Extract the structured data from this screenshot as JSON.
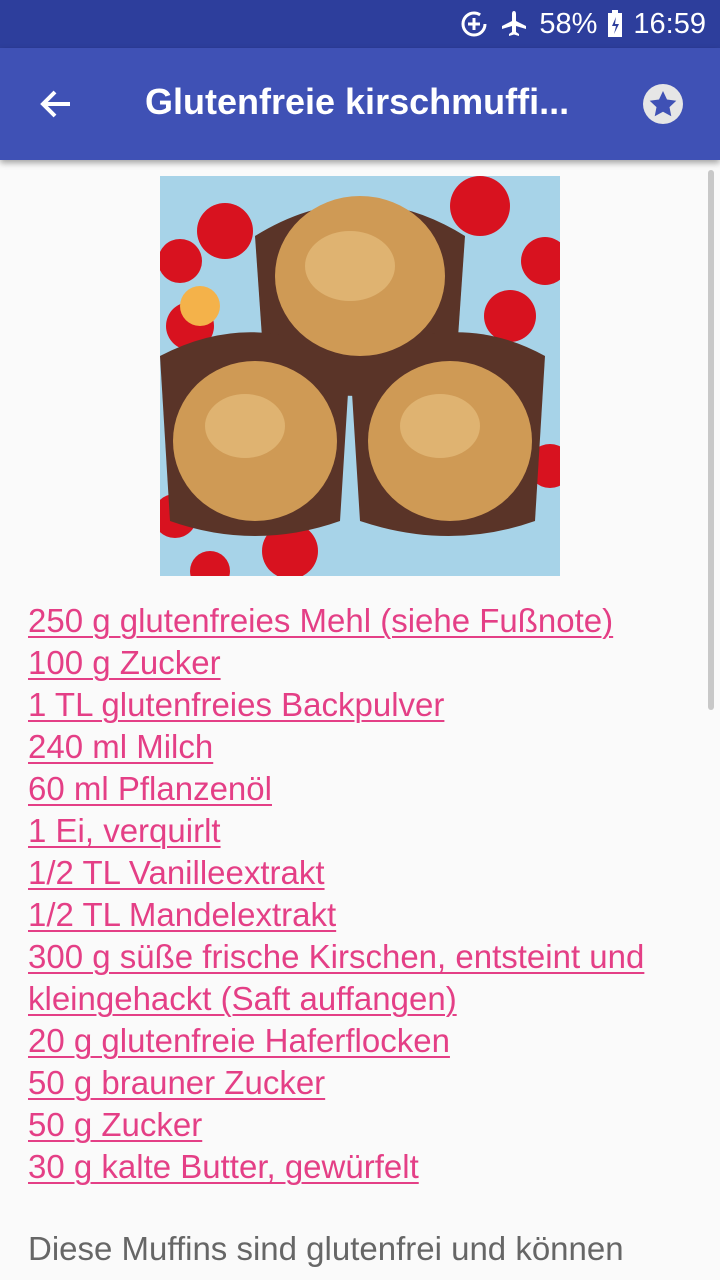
{
  "status_bar": {
    "battery": "58%",
    "time": "16:59"
  },
  "app_bar": {
    "title": "Glutenfreie kirschmuffi..."
  },
  "recipe": {
    "ingredients": [
      "250 g glutenfreies Mehl (siehe Fußnote)",
      "100 g Zucker",
      "1 TL glutenfreies Backpulver",
      "240 ml Milch",
      "60 ml Pflanzenöl",
      "1 Ei, verquirlt",
      "1/2 TL Vanilleextrakt",
      "1/2 TL Mandelextrakt",
      "300 g süße frische Kirschen, entsteint und kleingehackt (Saft auffangen)",
      "20 g glutenfreie Haferflocken",
      "50 g brauner Zucker",
      "50 g Zucker",
      "30 g kalte Butter, gewürfelt"
    ],
    "description": "Diese Muffins sind glutenfrei und können"
  },
  "colors": {
    "status_bar": "#2d3e9c",
    "app_bar": "#3f51b5",
    "link": "#e43f86"
  },
  "icons": [
    "data-saver-icon",
    "airplane-mode-icon",
    "battery-icon",
    "back-arrow-icon",
    "favorite-star-icon"
  ]
}
